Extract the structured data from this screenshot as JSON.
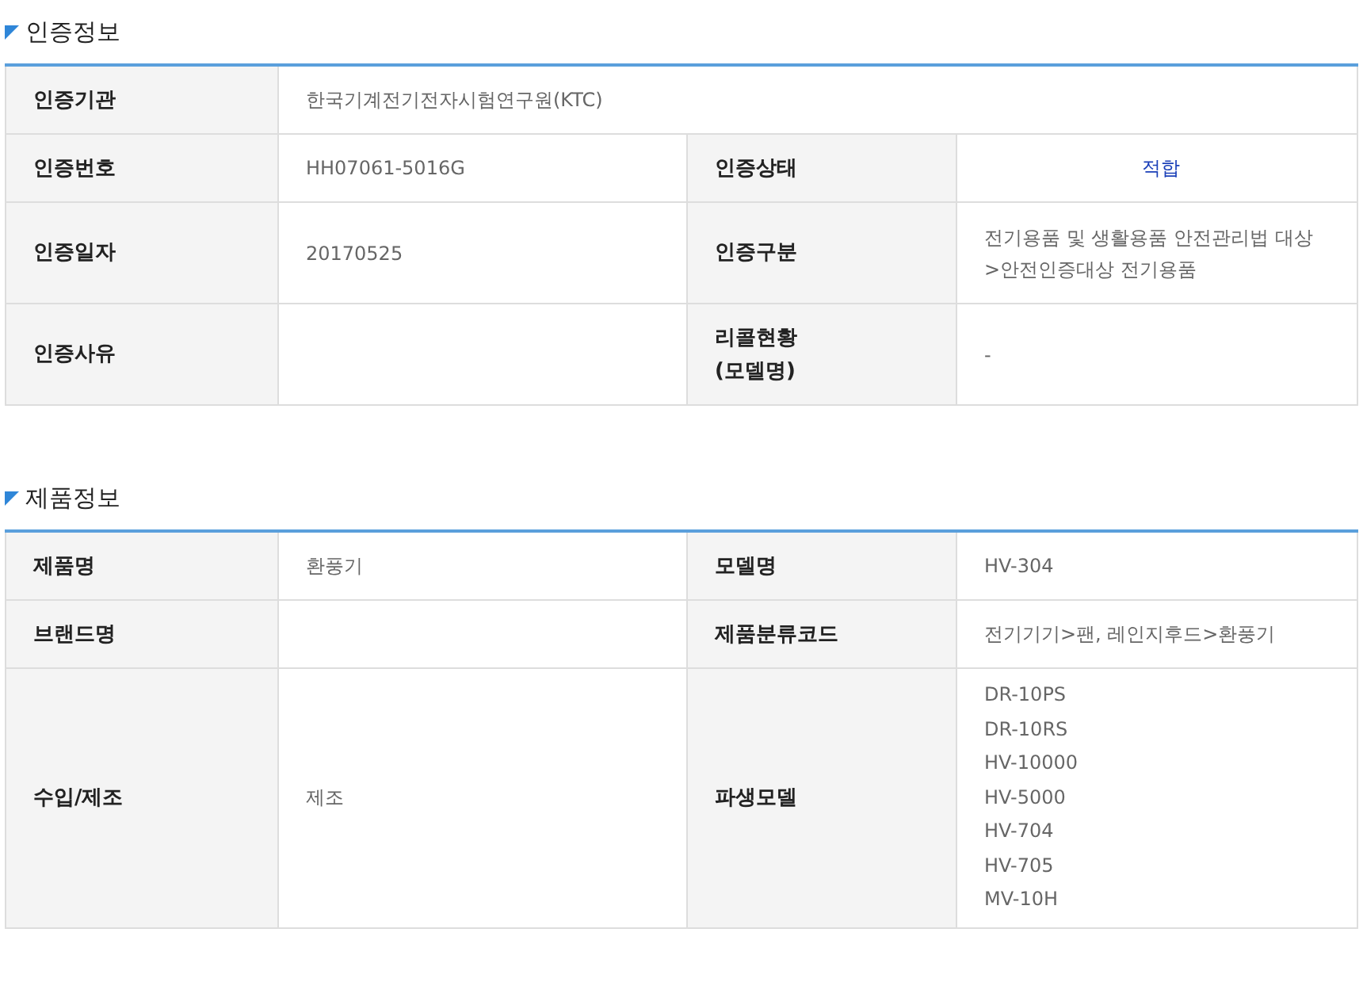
{
  "sections": [
    {
      "title": "인증정보",
      "rows": [
        {
          "pairs": [
            {
              "label": "인증기관",
              "value": {
                "kind": "text",
                "lines": [
                  "한국기계전기전자시험연구원(KTC)"
                ]
              }
            }
          ]
        },
        {
          "pairs": [
            {
              "label": "인증번호",
              "value": {
                "kind": "text",
                "lines": [
                  "HH07061-5016G"
                ]
              }
            },
            {
              "label": "인증상태",
              "value": {
                "kind": "status",
                "lines": [
                  "적합"
                ]
              }
            }
          ]
        },
        {
          "pairs": [
            {
              "label": "인증일자",
              "value": {
                "kind": "text",
                "lines": [
                  "20170525"
                ]
              }
            },
            {
              "label": "인증구분",
              "value": {
                "kind": "text",
                "lines": [
                  "전기용품 및 생활용품 안전관리법 대상",
                  ">안전인증대상 전기용품"
                ]
              }
            }
          ]
        },
        {
          "pairs": [
            {
              "label": "인증사유"
            },
            {
              "label": "리콜현황\n(모델명)",
              "value": {
                "kind": "text",
                "lines": [
                  "-"
                ]
              }
            }
          ]
        }
      ]
    },
    {
      "title": "제품정보",
      "rows": [
        {
          "pairs": [
            {
              "label": "제품명",
              "value": {
                "kind": "text",
                "lines": [
                  "환풍기"
                ]
              }
            },
            {
              "label": "모델명",
              "value": {
                "kind": "text",
                "lines": [
                  "HV-304"
                ]
              }
            }
          ]
        },
        {
          "pairs": [
            {
              "label": "브랜드명"
            },
            {
              "label": "제품분류코드",
              "value": {
                "kind": "text",
                "lines": [
                  "전기기기>팬, 레인지후드>환풍기"
                ]
              }
            }
          ]
        },
        {
          "pairs": [
            {
              "label": "수입/제조",
              "value": {
                "kind": "text",
                "lines": [
                  "제조"
                ]
              }
            },
            {
              "label": "파생모델",
              "value": {
                "kind": "list",
                "lines": [
                  "DR-10PS",
                  "DR-10RS",
                  "HV-10000",
                  "HV-5000",
                  "HV-704",
                  "HV-705",
                  "MV-10H"
                ]
              }
            }
          ]
        }
      ]
    }
  ]
}
